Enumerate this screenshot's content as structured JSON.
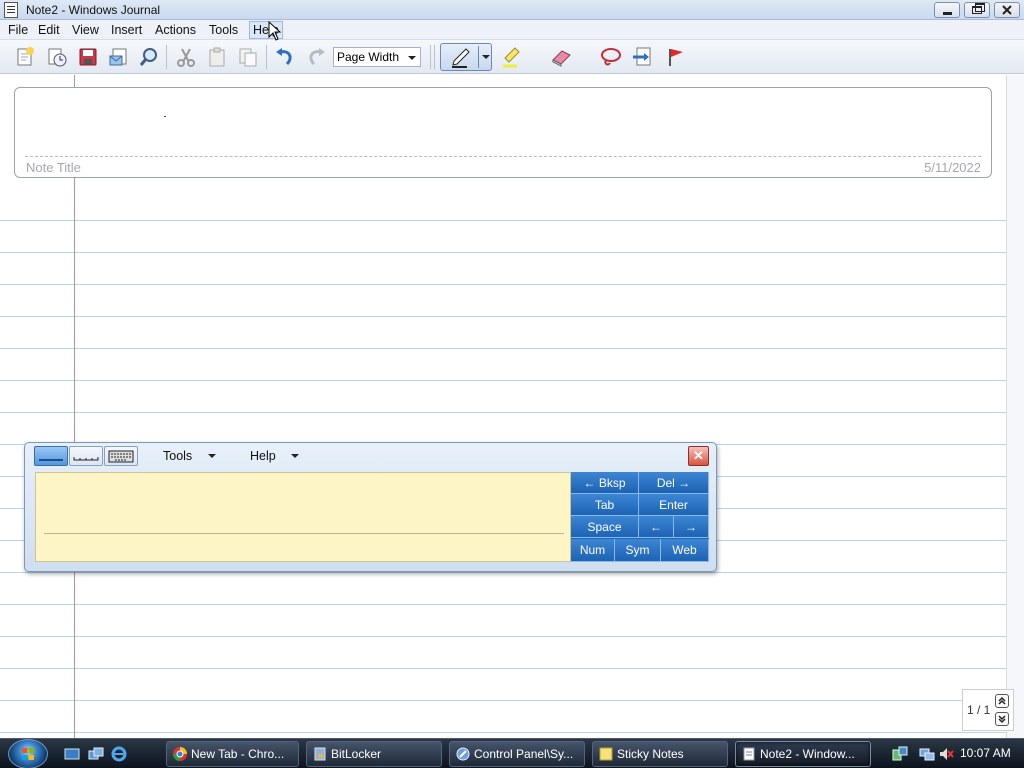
{
  "window": {
    "title": "Note2 - Windows Journal"
  },
  "menubar": {
    "items": [
      "File",
      "Edit",
      "View",
      "Insert",
      "Actions",
      "Tools",
      "Help"
    ]
  },
  "toolbar": {
    "zoom_value": "Page Width",
    "icons": [
      "new-note-icon",
      "open-recent-icon",
      "save-icon",
      "send-email-icon",
      "find-icon",
      "cut-icon",
      "paste-icon",
      "copy-icon",
      "undo-icon",
      "redo-icon",
      "pen-icon",
      "highlighter-icon",
      "eraser-icon",
      "lasso-select-icon",
      "insert-space-icon",
      "flag-icon"
    ]
  },
  "note": {
    "title_placeholder": "Note Title",
    "date": "5/11/2022",
    "page_indicator": "1 / 1"
  },
  "input_panel": {
    "menu_tools": "Tools",
    "menu_help": "Help",
    "close_glyph": "✕",
    "keys": {
      "bksp": "← Bksp",
      "del": "Del →",
      "tab": "Tab",
      "enter": "Enter",
      "space": "Space",
      "left": "←",
      "right": "→",
      "num": "Num",
      "sym": "Sym",
      "web": "Web"
    }
  },
  "taskbar": {
    "buttons": [
      {
        "label": "New Tab - Chro...",
        "active": false
      },
      {
        "label": "BitLocker",
        "active": false
      },
      {
        "label": "Control Panel\\Sy...",
        "active": false
      },
      {
        "label": "Sticky Notes",
        "active": false
      },
      {
        "label": "Note2 - Window...",
        "active": true
      }
    ],
    "clock": "10:07 AM"
  },
  "colors": {
    "rule_line": "#b9d3ef",
    "margin_line": "#c88a9c",
    "writing_pad": "#fdf5c5",
    "keypad": "#1d63b4"
  }
}
